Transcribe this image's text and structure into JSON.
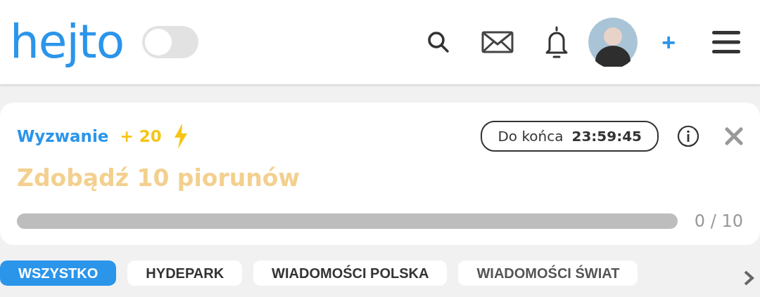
{
  "header": {
    "logo": "hejto",
    "dark_mode": {
      "on": false
    },
    "add_label": "+"
  },
  "challenge": {
    "label": "Wyzwanie",
    "reward": "+ 20",
    "deadline_label": "Do końca",
    "deadline_time": "23:59:45",
    "title": "Zdobądź 10 piorunów",
    "level": 0,
    "progress_text": "0 / 10"
  },
  "categories": [
    {
      "label": "WSZYSTKO",
      "selected": true
    },
    {
      "label": "HYDEPARK",
      "selected": false
    },
    {
      "label": "WIADOMOŚCI POLSKA",
      "selected": false
    },
    {
      "label": "WIADOMOŚCI ŚWIAT",
      "selected": false
    }
  ]
}
